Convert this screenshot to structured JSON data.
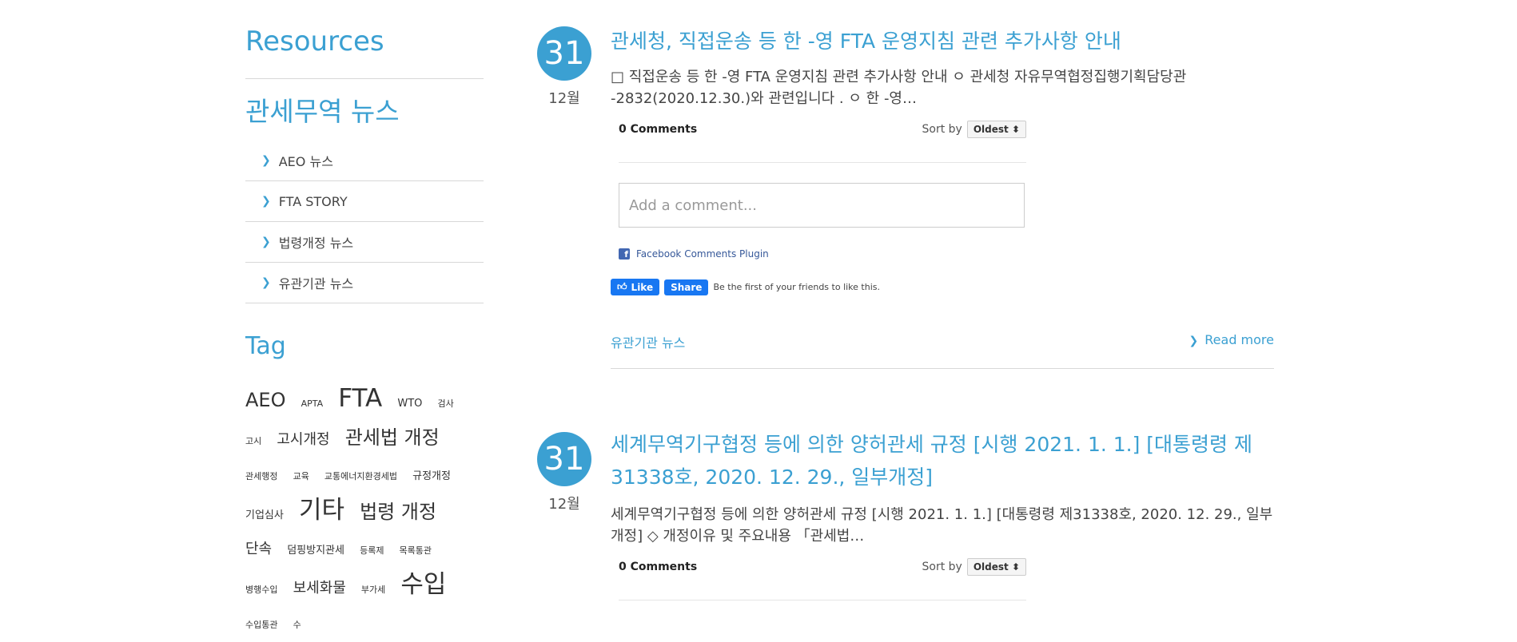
{
  "sidebar": {
    "resources_title": "Resources",
    "news_title": "관세무역 뉴스",
    "menu": [
      {
        "label": "AEO 뉴스"
      },
      {
        "label": "FTA STORY"
      },
      {
        "label": "법령개정 뉴스"
      },
      {
        "label": "유관기관 뉴스"
      }
    ],
    "tag_title": "Tag",
    "tags": [
      {
        "text": "AEO",
        "size": "l"
      },
      {
        "text": "APTA",
        "size": "xs"
      },
      {
        "text": "FTA",
        "size": "xl"
      },
      {
        "text": "WTO",
        "size": "s"
      },
      {
        "text": "검사",
        "size": "xs"
      },
      {
        "text": "고시",
        "size": "xs"
      },
      {
        "text": "고시개정",
        "size": "m"
      },
      {
        "text": "관세법 개정",
        "size": "l"
      },
      {
        "text": "관세행정",
        "size": "xs"
      },
      {
        "text": "교육",
        "size": "xs"
      },
      {
        "text": "교통에너지환경세법",
        "size": "xs"
      },
      {
        "text": "규정개정",
        "size": "s"
      },
      {
        "text": "기업심사",
        "size": "s"
      },
      {
        "text": "기타",
        "size": "xl"
      },
      {
        "text": "법령 개정",
        "size": "l"
      },
      {
        "text": "단속",
        "size": "m"
      },
      {
        "text": "덤핑방지관세",
        "size": "s"
      },
      {
        "text": "등록제",
        "size": "xs"
      },
      {
        "text": "목록통관",
        "size": "xs"
      },
      {
        "text": "병행수입",
        "size": "xs"
      },
      {
        "text": "보세화물",
        "size": "m"
      },
      {
        "text": "부가세",
        "size": "xs"
      },
      {
        "text": "수입",
        "size": "xl"
      },
      {
        "text": "수입통관",
        "size": "xs"
      },
      {
        "text": "수",
        "size": "xs"
      }
    ]
  },
  "posts": [
    {
      "day": "31",
      "month": "12월",
      "title": "관세청, 직접운송 등 한 -영 FTA 운영지침 관련 추가사항 안내",
      "excerpt": "□ 직접운송 등 한 -영 FTA 운영지침 관련 추가사항 안내 ㅇ 관세청 자유무역협정집행기획담당관 -2832(2020.12.30.)와 관련입니다 .      ㅇ 한 -영…",
      "comments": {
        "count_label": "0 Comments",
        "sort_label": "Sort by",
        "sort_value": "Oldest ⬍",
        "placeholder": "Add a comment...",
        "plugin_label": "Facebook Comments Plugin"
      },
      "like": {
        "like_label": "Like",
        "share_label": "Share",
        "text": "Be the first of your friends to like this."
      },
      "category": "유관기관 뉴스",
      "read_more": "Read more"
    },
    {
      "day": "31",
      "month": "12월",
      "title": "세계무역기구협정 등에 의한 양허관세 규정 [시행 2021. 1. 1.] [대통령령 제31338호, 2020. 12. 29., 일부개정]",
      "excerpt": "세계무역기구협정 등에 의한 양허관세 규정 [시행 2021. 1. 1.] [대통령령 제31338호, 2020. 12. 29., 일부개정] ◇ 개정이유 및 주요내용 「관세법…",
      "comments": {
        "count_label": "0 Comments",
        "sort_label": "Sort by",
        "sort_value": "Oldest ⬍"
      }
    }
  ]
}
